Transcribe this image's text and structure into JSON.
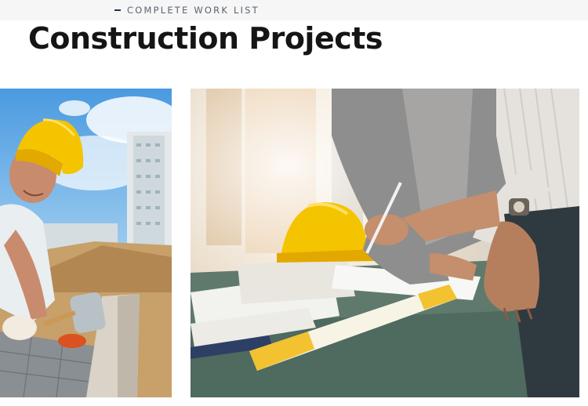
{
  "header": {
    "kicker": "COMPLETE WORK LIST",
    "title": "Construction Projects"
  },
  "projects": [
    {
      "image": "worker-laying-paving-stones-photo"
    },
    {
      "image": "engineers-reviewing-blueprints-photo"
    }
  ],
  "colors": {
    "kicker_dash": "#1c3356",
    "title": "#151515",
    "hard_hat": "#f5c400"
  }
}
